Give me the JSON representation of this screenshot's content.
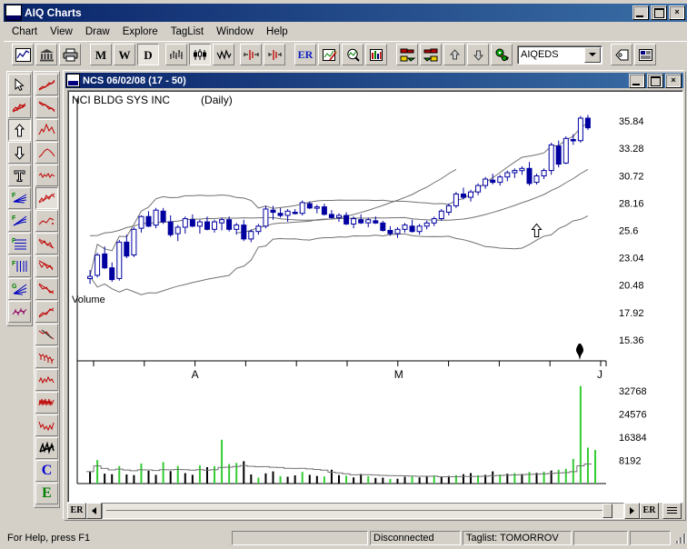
{
  "window": {
    "title": "AIQ Charts",
    "logo_icon": "aiq-logo-icon",
    "minimize": "minimize-icon",
    "maximize": "maximize-icon",
    "close": "×"
  },
  "menu": {
    "items": [
      {
        "label": "Chart",
        "accel": "C"
      },
      {
        "label": "View",
        "accel": "V"
      },
      {
        "label": "Draw",
        "accel": "D"
      },
      {
        "label": "Explore",
        "accel": "E"
      },
      {
        "label": "TagList",
        "accel": "g"
      },
      {
        "label": "Window",
        "accel": "W"
      },
      {
        "label": "Help",
        "accel": "H"
      }
    ]
  },
  "toolbar": {
    "buttons": [
      {
        "name": "new-chart-icon",
        "label": "",
        "state": "raised"
      },
      {
        "name": "fundamentals-icon",
        "label": "",
        "state": "raised"
      },
      {
        "name": "print-icon",
        "label": "",
        "state": "raised"
      },
      {
        "name": "monthly-button",
        "label": "M",
        "state": "raised"
      },
      {
        "name": "weekly-button",
        "label": "W",
        "state": "raised"
      },
      {
        "name": "daily-button",
        "label": "D",
        "state": "pressed"
      },
      {
        "name": "bar-chart-icon",
        "label": "",
        "state": "raised"
      },
      {
        "name": "candlestick-chart-icon",
        "label": "",
        "state": "pressed"
      },
      {
        "name": "line-chart-icon",
        "label": "",
        "state": "raised"
      },
      {
        "name": "zoom-in-icon",
        "label": "",
        "state": "raised"
      },
      {
        "name": "zoom-out-icon",
        "label": "",
        "state": "raised"
      },
      {
        "name": "expert-rating-button",
        "label": "ER",
        "state": "raised"
      },
      {
        "name": "notes-icon",
        "label": "",
        "state": "raised"
      },
      {
        "name": "search-icon",
        "label": "",
        "state": "raised"
      },
      {
        "name": "indicator-icon",
        "label": "",
        "state": "raised"
      },
      {
        "name": "export-right-icon",
        "label": "",
        "state": "raised"
      },
      {
        "name": "import-left-icon",
        "label": "",
        "state": "raised"
      },
      {
        "name": "move-up-icon",
        "label": "",
        "state": "raised"
      },
      {
        "name": "move-down-icon",
        "label": "",
        "state": "raised"
      },
      {
        "name": "settings-icon",
        "label": "",
        "state": "raised"
      },
      {
        "name": "tag-icon",
        "label": "",
        "state": "raised"
      },
      {
        "name": "report-icon",
        "label": "",
        "state": "raised"
      }
    ],
    "taglist_combo": {
      "value": "AIQEDS",
      "arrow": "chevron-down-icon"
    }
  },
  "palette": {
    "column_a": [
      {
        "name": "pointer-tool",
        "state": "raised"
      },
      {
        "name": "trendline-tool",
        "state": "raised"
      },
      {
        "name": "up-arrow-tool",
        "state": "sel"
      },
      {
        "name": "down-arrow-tool",
        "state": "raised"
      },
      {
        "name": "text-tool",
        "state": "raised"
      },
      {
        "name": "fib-fan-tool",
        "state": "raised"
      },
      {
        "name": "fib-arc-tool",
        "state": "raised"
      },
      {
        "name": "fib-retrace-tool",
        "state": "raised"
      },
      {
        "name": "fib-timezone-tool",
        "state": "raised"
      },
      {
        "name": "gann-fan-tool",
        "state": "raised"
      },
      {
        "name": "regression-tool",
        "state": "raised"
      }
    ],
    "column_b": [
      {
        "name": "uptrend-pattern",
        "state": "raised"
      },
      {
        "name": "downtrend-pattern",
        "state": "raised"
      },
      {
        "name": "peak-pattern",
        "state": "raised"
      },
      {
        "name": "rounding-pattern",
        "state": "raised"
      },
      {
        "name": "consolidation-pattern",
        "state": "raised"
      },
      {
        "name": "breakout-pattern",
        "state": "sel"
      },
      {
        "name": "pullback-pattern",
        "state": "raised"
      },
      {
        "name": "head-shoulders-pattern",
        "state": "raised"
      },
      {
        "name": "wedge-pattern",
        "state": "raised"
      },
      {
        "name": "descending-pattern",
        "state": "raised"
      },
      {
        "name": "ascending-pattern",
        "state": "raised"
      },
      {
        "name": "reversal-pattern",
        "state": "raised"
      },
      {
        "name": "declining-pattern",
        "state": "raised"
      },
      {
        "name": "sideways-pattern",
        "state": "raised"
      },
      {
        "name": "volatile-pattern",
        "state": "raised"
      },
      {
        "name": "bottom-pattern",
        "state": "raised"
      },
      {
        "name": "scribble-tool",
        "state": "raised"
      },
      {
        "name": "control-button",
        "label": "C",
        "state": "raised"
      },
      {
        "name": "expert-button",
        "label": "E",
        "state": "raised"
      }
    ]
  },
  "chart_window": {
    "title": "NCS 06/02/08 (17 - 50)",
    "icon": "chart-window-icon",
    "minimize": "minimize-icon",
    "maximize": "maximize-icon",
    "close": "×",
    "symbol_name": "NCI BLDG SYS INC",
    "period": "(Daily)",
    "volume_label": "Volume",
    "footer": {
      "er_left": "ER",
      "er_right": "ER",
      "left_arrow": "left-arrow-icon",
      "right_arrow": "right-arrow-icon",
      "list_button": "list-icon"
    }
  },
  "status": {
    "help": "For Help, press F1",
    "blank1": "",
    "connection": "Disconnected",
    "taglist": "Taglist: TOMORROV",
    "blank2": "",
    "blank3": ""
  },
  "colors": {
    "title_gradient_start": "#0a246a",
    "title_gradient_end": "#3a6ea5",
    "face": "#d4d0c8",
    "candle_blue": "#0000a0",
    "band_gray": "#707070",
    "volume_green": "#33cc33",
    "volume_black": "#000000"
  },
  "chart_data": {
    "type": "line",
    "title": "NCI BLDG SYS INC (Daily)",
    "subtitle": "NCS 06/02/08 (17 - 50)",
    "xlabel": "",
    "ylabel": "",
    "grid": false,
    "legend": "none",
    "price_panel": {
      "type": "candlestick",
      "ylim": [
        14.08,
        37.12
      ],
      "yticks": [
        35.84,
        33.28,
        30.72,
        28.16,
        25.6,
        23.04,
        20.48,
        17.92,
        15.36
      ],
      "ytick_labels": [
        "35.84",
        "33.28",
        "30.72",
        "28.16",
        "25.6",
        "23.04",
        "20.48",
        "17.92",
        "15.36"
      ],
      "xticks": [
        "",
        "",
        "A",
        "",
        "",
        "",
        "M",
        "",
        "",
        "",
        "J"
      ],
      "xtick_labels_visible": [
        "A",
        "M",
        "J"
      ],
      "annotations": [
        {
          "type": "up-arrow-marker",
          "x_index": 61,
          "value": 26.2
        }
      ],
      "overlays": [
        {
          "name": "bollinger-upper",
          "color": "#707070"
        },
        {
          "name": "bollinger-middle",
          "color": "#707070"
        },
        {
          "name": "bollinger-lower",
          "color": "#707070"
        }
      ],
      "ohlc": [
        [
          21.1,
          21.9,
          20.6,
          21.3
        ],
        [
          21.4,
          23.5,
          21.2,
          23.3
        ],
        [
          23.4,
          24.1,
          22.0,
          22.1
        ],
        [
          22.1,
          22.6,
          20.8,
          21.0
        ],
        [
          21.1,
          24.7,
          20.9,
          24.5
        ],
        [
          24.5,
          25.2,
          23.0,
          23.2
        ],
        [
          23.3,
          25.9,
          23.1,
          25.7
        ],
        [
          25.8,
          27.0,
          25.4,
          26.9
        ],
        [
          26.9,
          27.4,
          25.9,
          26.0
        ],
        [
          26.1,
          27.7,
          25.8,
          27.5
        ],
        [
          27.4,
          27.7,
          26.2,
          26.4
        ],
        [
          26.4,
          27.0,
          25.0,
          25.2
        ],
        [
          25.3,
          26.1,
          24.6,
          25.9
        ],
        [
          25.9,
          26.9,
          25.3,
          26.7
        ],
        [
          26.6,
          27.1,
          25.9,
          26.0
        ],
        [
          26.0,
          26.6,
          25.3,
          26.4
        ],
        [
          26.4,
          26.9,
          25.6,
          25.7
        ],
        [
          25.7,
          26.6,
          25.4,
          26.4
        ],
        [
          26.3,
          26.8,
          25.6,
          26.6
        ],
        [
          26.6,
          26.9,
          25.5,
          25.7
        ],
        [
          25.7,
          26.3,
          25.2,
          26.1
        ],
        [
          26.1,
          26.6,
          24.6,
          24.8
        ],
        [
          24.8,
          25.7,
          24.5,
          25.5
        ],
        [
          25.5,
          26.2,
          25.2,
          26.0
        ],
        [
          26.0,
          27.9,
          25.8,
          27.6
        ],
        [
          27.5,
          27.9,
          26.6,
          27.3
        ],
        [
          27.2,
          27.7,
          26.8,
          27.0
        ],
        [
          27.0,
          27.6,
          26.4,
          27.4
        ],
        [
          27.3,
          27.6,
          27.1,
          27.2
        ],
        [
          27.2,
          28.4,
          27.0,
          28.2
        ],
        [
          28.1,
          28.3,
          27.6,
          27.7
        ],
        [
          27.7,
          28.0,
          27.2,
          27.8
        ],
        [
          27.8,
          28.1,
          27.0,
          27.1
        ],
        [
          27.1,
          27.5,
          26.7,
          26.8
        ],
        [
          26.8,
          27.2,
          26.4,
          27.0
        ],
        [
          27.0,
          27.3,
          26.1,
          26.2
        ],
        [
          26.2,
          26.9,
          25.8,
          26.7
        ],
        [
          26.6,
          27.1,
          26.2,
          26.3
        ],
        [
          26.3,
          26.8,
          25.9,
          26.6
        ],
        [
          26.5,
          26.9,
          26.2,
          26.3
        ],
        [
          26.3,
          26.5,
          25.5,
          25.6
        ],
        [
          25.6,
          26.0,
          25.1,
          25.3
        ],
        [
          25.3,
          25.9,
          24.9,
          25.7
        ],
        [
          25.7,
          26.3,
          25.4,
          26.1
        ],
        [
          26.0,
          26.6,
          25.4,
          25.5
        ],
        [
          25.5,
          26.2,
          25.2,
          26.0
        ],
        [
          26.0,
          26.5,
          25.7,
          26.3
        ],
        [
          26.3,
          26.9,
          26.0,
          26.7
        ],
        [
          26.7,
          27.6,
          26.5,
          27.4
        ],
        [
          27.3,
          28.1,
          27.0,
          27.9
        ],
        [
          27.9,
          29.2,
          27.7,
          29.0
        ],
        [
          29.0,
          29.6,
          28.5,
          28.7
        ],
        [
          28.7,
          29.4,
          28.3,
          29.2
        ],
        [
          29.2,
          30.0,
          28.9,
          29.8
        ],
        [
          29.8,
          30.6,
          29.5,
          30.4
        ],
        [
          30.3,
          30.9,
          29.9,
          30.1
        ],
        [
          30.1,
          30.8,
          29.8,
          30.6
        ],
        [
          30.6,
          31.2,
          30.2,
          31.0
        ],
        [
          31.0,
          31.4,
          30.5,
          31.2
        ],
        [
          31.2,
          31.6,
          30.8,
          31.4
        ],
        [
          31.4,
          32.0,
          29.8,
          30.0
        ],
        [
          30.1,
          30.9,
          29.9,
          30.7
        ],
        [
          30.7,
          31.4,
          30.4,
          31.2
        ],
        [
          31.2,
          33.8,
          30.8,
          33.6
        ],
        [
          33.5,
          34.0,
          31.5,
          31.8
        ],
        [
          31.9,
          34.4,
          31.8,
          34.2
        ],
        [
          34.1,
          34.6,
          33.6,
          34.0
        ],
        [
          34.0,
          36.3,
          33.8,
          36.1
        ],
        [
          36.1,
          36.4,
          35.0,
          35.2
        ]
      ]
    },
    "volume_panel": {
      "type": "bar",
      "ylim": [
        0,
        36000
      ],
      "yticks": [
        32768,
        24576,
        16384,
        8192
      ],
      "ytick_labels": [
        "32768",
        "24576",
        "16384",
        "8192"
      ],
      "values": [
        4200,
        8300,
        3500,
        3300,
        6200,
        3200,
        3000,
        7100,
        4500,
        3100,
        7600,
        4400,
        6200,
        3700,
        3100,
        6400,
        5800,
        6100,
        15500,
        6900,
        7300,
        7900,
        3200,
        2100,
        3600,
        4300,
        2600,
        2400,
        2900,
        4100,
        3100,
        2700,
        2500,
        4900,
        3000,
        2800,
        2200,
        3400,
        2600,
        2000,
        2100,
        1600,
        1700,
        2400,
        2500,
        2200,
        2600,
        2900,
        2400,
        2700,
        3000,
        3300,
        3700,
        2900,
        3100,
        4300,
        3200,
        3500,
        3700,
        3400,
        4100,
        3800,
        4200,
        4600,
        4900,
        5200,
        8700,
        34500,
        12700,
        11900
      ],
      "bar_colors": [
        "black",
        "green",
        "black",
        "black",
        "green",
        "black",
        "black",
        "green",
        "black",
        "black",
        "green",
        "black",
        "green",
        "black",
        "black",
        "green",
        "black",
        "green",
        "green",
        "green",
        "green",
        "black",
        "black",
        "green",
        "black",
        "black",
        "green",
        "black",
        "black",
        "green",
        "black",
        "black",
        "green",
        "black",
        "black",
        "green",
        "black",
        "black",
        "green",
        "black",
        "black",
        "green",
        "black",
        "black",
        "green",
        "black",
        "black",
        "green",
        "black",
        "black",
        "green",
        "black",
        "black",
        "green",
        "black",
        "black",
        "green",
        "black",
        "green",
        "black",
        "green",
        "black",
        "green",
        "black",
        "green",
        "green",
        "green",
        "green",
        "green",
        "green"
      ],
      "overlay": {
        "name": "volume-moving-average",
        "color": "#707070"
      }
    }
  }
}
